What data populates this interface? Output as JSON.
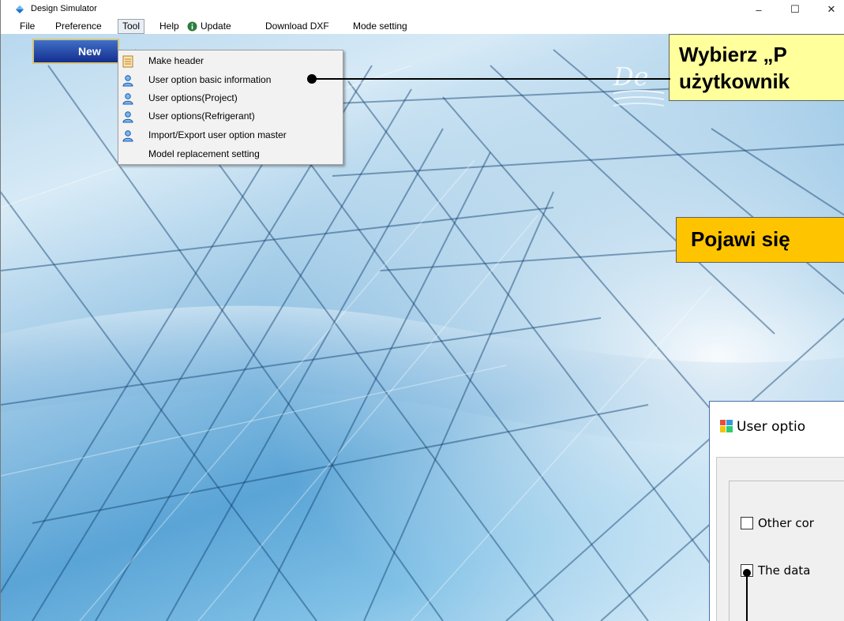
{
  "window": {
    "title": "Design Simulator",
    "minimize": "–",
    "maximize": "☐",
    "close": "✕"
  },
  "menubar": {
    "items": [
      "File",
      "Preference",
      "Tool",
      "Help",
      "Update",
      "Download DXF",
      "Mode setting"
    ],
    "active": "Tool"
  },
  "main": {
    "new_button": "New",
    "logo_fragment": "De"
  },
  "tool_menu": {
    "items": [
      {
        "label": "Make header",
        "icon": "document-icon"
      },
      {
        "label": "User option basic information",
        "icon": "user-icon"
      },
      {
        "label": "User options(Project)",
        "icon": "user-icon"
      },
      {
        "label": "User options(Refrigerant)",
        "icon": "user-icon"
      },
      {
        "label": "Import/Export user option master",
        "icon": "user-icon"
      },
      {
        "label": "Model replacement setting",
        "icon": ""
      }
    ]
  },
  "callouts": {
    "select_line1": "Wybierz „P",
    "select_line2": "użytkownik",
    "appears": "Pojawi się"
  },
  "dialog": {
    "title": "User optio",
    "option1": "Other cor",
    "option2": "The data"
  },
  "colors": {
    "callout_yellow": "#ffff9c",
    "callout_orange": "#ffc400",
    "menu_active_bg": "#e9eef5",
    "button_blue": "#1a3a9c"
  }
}
